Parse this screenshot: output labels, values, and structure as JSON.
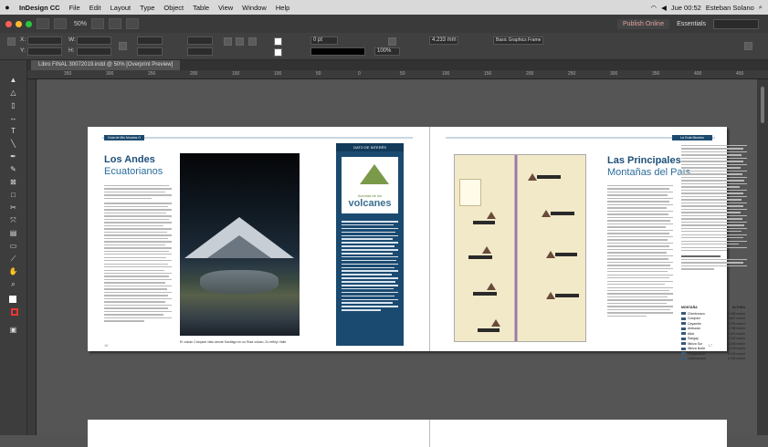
{
  "menubar": {
    "app_name": "InDesign CC",
    "items": [
      "File",
      "Edit",
      "Layout",
      "Type",
      "Object",
      "Table",
      "View",
      "Window",
      "Help"
    ],
    "clock": "Jue 00:52",
    "user": "Esteban Solano"
  },
  "appbar": {
    "zoom": "50%",
    "publish_label": "Publish Online",
    "workspace_label": "Essentials"
  },
  "control": {
    "font_field": "Basic Graphics Frame",
    "stroke_value": "0 pt",
    "opacity_value": "100%",
    "size_value": "4.233 mm"
  },
  "document": {
    "tab_title": "Libro FINAL 30072019.indd @ 50% [Overprint Preview]"
  },
  "ruler": {
    "ticks": [
      "350",
      "300",
      "250",
      "200",
      "150",
      "100",
      "50",
      "0",
      "50",
      "100",
      "150",
      "200",
      "250",
      "300",
      "350",
      "400",
      "450"
    ]
  },
  "left_page": {
    "header_tag": "Guía de Mis Mundos O",
    "title_line1": "Los Andes",
    "title_line2": "Ecuatorianos",
    "photo_caption": "El volcán Cotopaxi visto desde Santiago en su Ruta volcán, 2o reflejo Valle",
    "page_number": "16"
  },
  "sidebar": {
    "heading": "DATO DE INTERÉS",
    "logo_small": "Avenida de los",
    "logo_text": "volcanes"
  },
  "right_page": {
    "header_tag": "La Guía Mundos",
    "title_line1": "Las Principales",
    "title_line2": "Montañas del País",
    "table_header_left": "MONTAÑA",
    "table_header_right": "ALTURA",
    "table_rows": [
      {
        "name": "Chimborazo",
        "height": "6.268 msnm"
      },
      {
        "name": "Cotopaxi",
        "height": "5.897 msnm"
      },
      {
        "name": "Cayambe",
        "height": "5.790 msnm"
      },
      {
        "name": "Antisana",
        "height": "5.758 msnm"
      },
      {
        "name": "Altar",
        "height": "5.319 msnm"
      },
      {
        "name": "Sangay",
        "height": "5.230 msnm"
      },
      {
        "name": "Illiniza Sur",
        "height": "5.248 msnm"
      },
      {
        "name": "Illiniza Norte",
        "height": "5.126 msnm"
      },
      {
        "name": "Tungurahua",
        "height": "5.023 msnm"
      },
      {
        "name": "Carihuairazo",
        "height": "5.018 msnm"
      }
    ],
    "page_number": "17"
  },
  "colors": {
    "accent_blue": "#1b4a70",
    "title_blue": "#1d4f7a"
  }
}
